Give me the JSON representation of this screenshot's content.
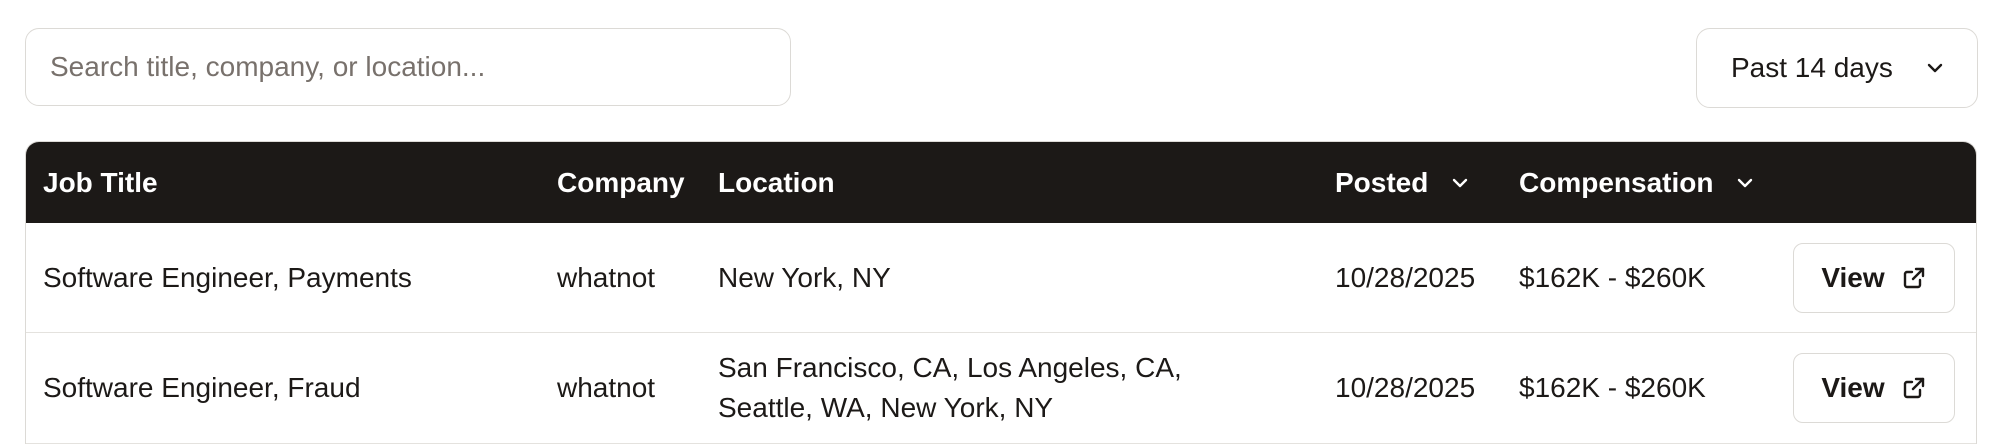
{
  "search": {
    "placeholder": "Search title, company, or location..."
  },
  "filter": {
    "selected": "Past 14 days"
  },
  "table": {
    "columns": {
      "job_title": "Job Title",
      "company": "Company",
      "location": "Location",
      "posted": "Posted",
      "compensation": "Compensation"
    },
    "rows": [
      {
        "title": "Software Engineer, Payments",
        "company": "whatnot",
        "location_line1": "New York, NY",
        "location_line2": "",
        "posted": "10/28/2025",
        "compensation": "$162K - $260K",
        "action": "View"
      },
      {
        "title": "Software Engineer, Fraud",
        "company": "whatnot",
        "location_line1": "San Francisco, CA, Los Angeles, CA,",
        "location_line2": "Seattle, WA, New York, NY",
        "posted": "10/28/2025",
        "compensation": "$162K - $260K",
        "action": "View"
      }
    ]
  },
  "colors": {
    "header_bg": "#1c1917",
    "header_text": "#ffffff",
    "border": "#dcdad6"
  }
}
